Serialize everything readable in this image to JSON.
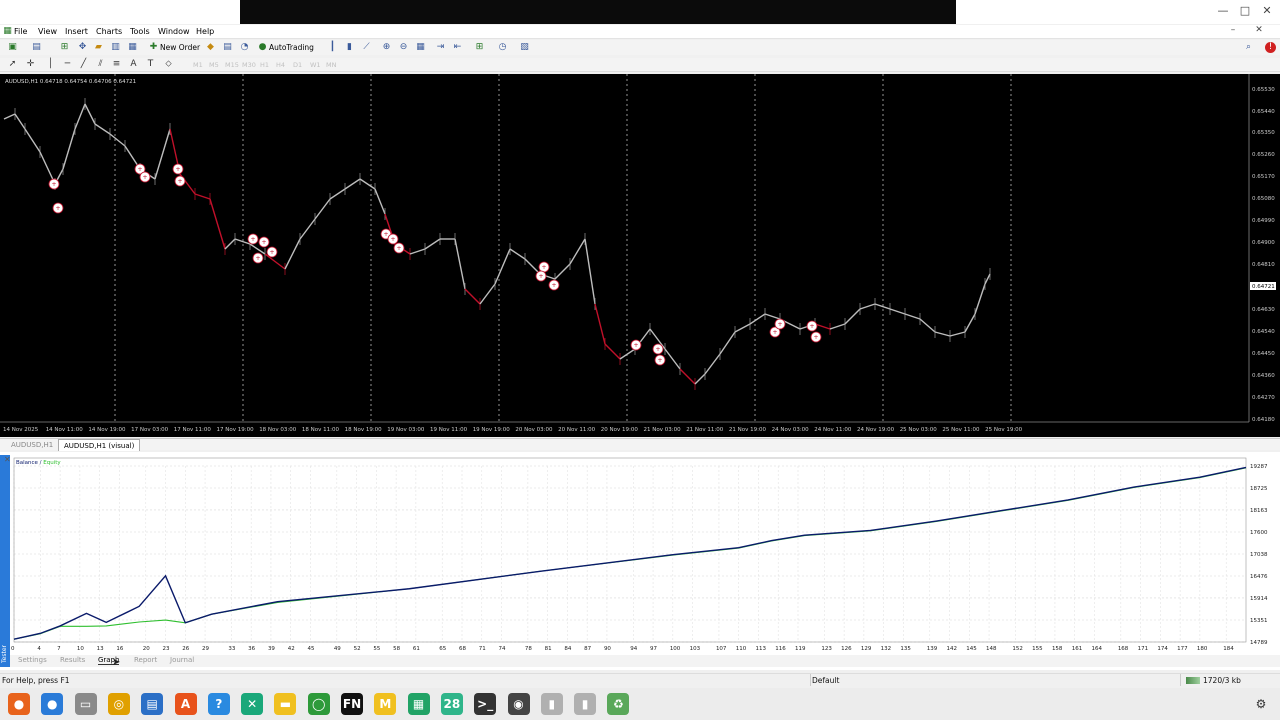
{
  "window": {
    "controls": [
      "—",
      "□",
      "✕"
    ]
  },
  "menu": [
    "File",
    "View",
    "Insert",
    "Charts",
    "Tools",
    "Window",
    "Help"
  ],
  "toolbar": {
    "new_order": "New Order",
    "autotrading": "AutoTrading",
    "timeframes": [
      "M1",
      "M5",
      "M15",
      "M30",
      "H1",
      "H4",
      "D1",
      "W1",
      "MN"
    ]
  },
  "chart": {
    "header": "AUDUSD,H1  0.64718 0.64754 0.64706 0.64721",
    "price_labels": [
      "0.65530",
      "0.65440",
      "0.65350",
      "0.65260",
      "0.65170",
      "0.65080",
      "0.64990",
      "0.64900",
      "0.64810",
      "0.64721",
      "0.64630",
      "0.64540",
      "0.64450",
      "0.64360",
      "0.64270",
      "0.64180"
    ],
    "current_price": "0.64721",
    "time_labels": [
      "14 Nov 2025",
      "14 Nov 11:00",
      "14 Nov 19:00",
      "17 Nov 03:00",
      "17 Nov 11:00",
      "17 Nov 19:00",
      "18 Nov 03:00",
      "18 Nov 11:00",
      "18 Nov 19:00",
      "19 Nov 03:00",
      "19 Nov 11:00",
      "19 Nov 19:00",
      "20 Nov 03:00",
      "20 Nov 11:00",
      "20 Nov 19:00",
      "21 Nov 03:00",
      "21 Nov 11:00",
      "21 Nov 19:00",
      "24 Nov 03:00",
      "24 Nov 11:00",
      "24 Nov 19:00",
      "25 Nov 03:00",
      "25 Nov 11:00",
      "25 Nov 19:00"
    ],
    "colors": {
      "background": "#000000",
      "up": "#bdbdbd",
      "down": "#c0102a",
      "grid": "#d0d0d0"
    }
  },
  "chart_tabs": [
    "AUDUSD,H1",
    "AUDUSD,H1 (visual)"
  ],
  "tester": {
    "legend_balance": "Balance",
    "legend_sep": " / ",
    "legend_equity": "Equity",
    "tabs": [
      "Settings",
      "Results",
      "Graph",
      "Report",
      "Journal"
    ],
    "active_tab": "Graph",
    "side_label": "Tester"
  },
  "chart_data": {
    "type": "line",
    "title": "",
    "xlabel": "",
    "ylabel": "",
    "x_ticks": [
      0,
      4,
      7,
      10,
      13,
      16,
      20,
      23,
      26,
      29,
      33,
      36,
      39,
      42,
      45,
      49,
      52,
      55,
      58,
      61,
      65,
      68,
      71,
      74,
      78,
      81,
      84,
      87,
      90,
      94,
      97,
      100,
      103,
      107,
      110,
      113,
      116,
      119,
      123,
      126,
      129,
      132,
      135,
      139,
      142,
      145,
      148,
      152,
      155,
      158,
      161,
      164,
      168,
      171,
      174,
      177,
      180,
      184
    ],
    "y_ticks": [
      "14789",
      "15351",
      "15914",
      "16476",
      "17038",
      "17600",
      "18163",
      "18725",
      "19287"
    ],
    "ylim": [
      14789,
      19287
    ],
    "xlim": [
      0,
      187
    ],
    "grid": true,
    "legend": "top-left",
    "series": [
      {
        "name": "Balance",
        "color": "#0a1a6a",
        "x": [
          0,
          4,
          7,
          11,
          14,
          19,
          23,
          26,
          30,
          40,
          60,
          80,
          100,
          110,
          115,
          120,
          130,
          140,
          150,
          160,
          170,
          180,
          187
        ],
        "values": [
          14860,
          15010,
          15200,
          15520,
          15290,
          15700,
          16480,
          15280,
          15500,
          15820,
          16150,
          16600,
          17020,
          17200,
          17380,
          17520,
          17640,
          17880,
          18150,
          18420,
          18750,
          19000,
          19250
        ]
      },
      {
        "name": "Equity",
        "color": "#2fbf2f",
        "x": [
          0,
          4,
          7,
          11,
          14,
          19,
          23,
          26,
          30,
          40,
          60,
          80,
          100,
          110,
          115,
          120,
          130,
          140,
          150,
          160,
          170,
          180,
          187
        ],
        "values": [
          14860,
          15000,
          15190,
          15190,
          15200,
          15300,
          15350,
          15280,
          15500,
          15800,
          16150,
          16600,
          17010,
          17190,
          17370,
          17510,
          17630,
          17870,
          18140,
          18410,
          18740,
          18990,
          19240
        ]
      }
    ]
  },
  "status": {
    "help": "For Help, press F1",
    "profile": "Default",
    "traffic": "1720/3 kb"
  },
  "taskbar": [
    {
      "name": "firefox-icon",
      "glyph": "●",
      "color": "#e8631c"
    },
    {
      "name": "chrome-icon",
      "glyph": "●",
      "color": "#2a7bd8"
    },
    {
      "name": "files-icon",
      "glyph": "▭",
      "color": "#8a8a8a"
    },
    {
      "name": "rhythmbox-icon",
      "glyph": "◎",
      "color": "#e0a000"
    },
    {
      "name": "text-editor-icon",
      "glyph": "▤",
      "color": "#2b6fc6"
    },
    {
      "name": "software-center-icon",
      "glyph": "A",
      "color": "#e8531c"
    },
    {
      "name": "help-icon",
      "glyph": "?",
      "color": "#2a8ae0"
    },
    {
      "name": "tools-icon",
      "glyph": "✕",
      "color": "#1aa87a"
    },
    {
      "name": "notes-icon",
      "glyph": "▬",
      "color": "#f0c020"
    },
    {
      "name": "terminal-ring-icon",
      "glyph": "◯",
      "color": "#2e9a3a"
    },
    {
      "name": "fn-app-icon",
      "glyph": "FN",
      "color": "#111111"
    },
    {
      "name": "m-app-icon",
      "glyph": "M",
      "color": "#f0c020"
    },
    {
      "name": "spreadsheet-icon",
      "glyph": "▦",
      "color": "#21a366"
    },
    {
      "name": "calendar-icon",
      "glyph": "28",
      "color": "#2fb58a"
    },
    {
      "name": "console-icon",
      "glyph": ">_",
      "color": "#333333"
    },
    {
      "name": "obs-icon",
      "glyph": "◉",
      "color": "#444444"
    },
    {
      "name": "usb-drive-icon",
      "glyph": "▮",
      "color": "#b0b0b0"
    },
    {
      "name": "usb-drive-2-icon",
      "glyph": "▮",
      "color": "#b0b0b0"
    },
    {
      "name": "trash-icon",
      "glyph": "♻",
      "color": "#5aa85a"
    }
  ]
}
